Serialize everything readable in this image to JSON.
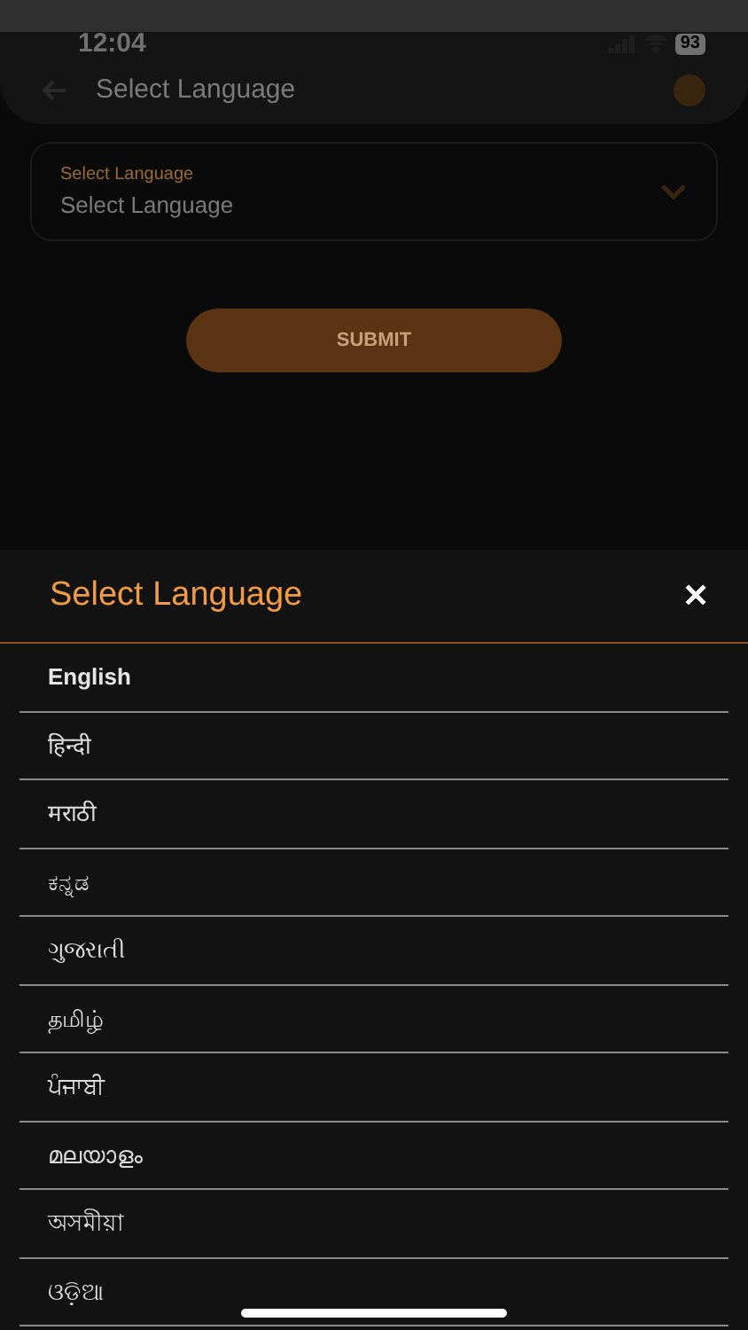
{
  "status_bar": {
    "time": "12:04",
    "battery": "93"
  },
  "app_bar": {
    "title": "Select Language"
  },
  "language_field": {
    "label": "Select Language",
    "placeholder": "Select Language"
  },
  "submit_button": {
    "label": "SUBMIT"
  },
  "sheet": {
    "title": "Select Language",
    "close": "✕",
    "languages": [
      {
        "label": "English",
        "selected": true
      },
      {
        "label": "हिन्दी",
        "selected": false
      },
      {
        "label": "मराठी",
        "selected": false
      },
      {
        "label": "ಕನ್ನಡ",
        "selected": false
      },
      {
        "label": "ગુજરાતી",
        "selected": false
      },
      {
        "label": "தமிழ்",
        "selected": false
      },
      {
        "label": "ਪੰਜਾਬੀ",
        "selected": false
      },
      {
        "label": "മലയാളം",
        "selected": false
      },
      {
        "label": "অসমীয়া",
        "selected": false
      },
      {
        "label": "ଓଡ଼ିଆ",
        "selected": false
      }
    ]
  }
}
